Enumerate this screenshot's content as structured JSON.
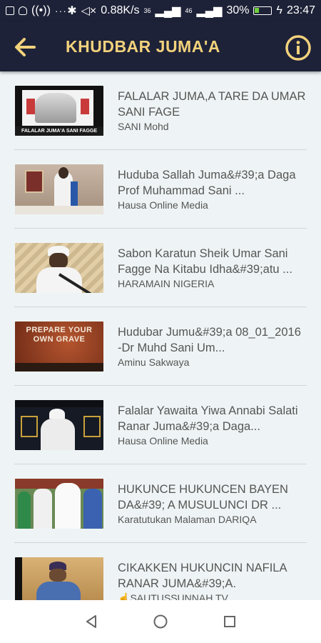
{
  "status_bar": {
    "speed": "0.88K/s",
    "sim1": "36",
    "sim2": "46",
    "battery_percent": "30%",
    "battery_level": 0.3,
    "time": "23:47"
  },
  "toolbar": {
    "title": "KHUDBAR JUMA'A",
    "back_icon": "arrow-left-icon",
    "info_icon": "info-circle-icon",
    "title_color": "#f3d27c",
    "background": "#1e2238"
  },
  "videos": [
    {
      "title": "FALALAR JUMA,A TARE DA UMAR SANI FAGE",
      "channel": "SANI Mohd",
      "thumb_caption": "FALALAR JUMA'A SANI FAGGE"
    },
    {
      "title": "Huduba Sallah Juma&#39;a Daga Prof Muhammad Sani ...",
      "channel": "Hausa Online Media"
    },
    {
      "title": "Sabon Karatun Sheik Umar Sani Fagge Na Kitabu Idha&#39;atu ...",
      "channel": "HARAMAIN NIGERIA"
    },
    {
      "title": "Hudubar Jumu&#39;a 08_01_2016 -Dr Muhd Sani Um...",
      "channel": "Aminu Sakwaya",
      "thumb_caption": "PREPARE YOUR OWN GRAVE"
    },
    {
      "title": "Falalar Yawaita Yiwa Annabi Salati Ranar Juma&#39;a Daga...",
      "channel": "Hausa Online Media"
    },
    {
      "title": "HUKUNCE HUKUNCEN BAYEN DA&#39; A MUSULUNCI DR ...",
      "channel": "Karatutukan Malaman DARIQA"
    },
    {
      "title": "CIKAKKEN HUKUNCIN NAFILA RANAR JUMA&#39;A.",
      "channel": "SAUTUSSUNNAH TV"
    }
  ],
  "nav": {
    "back": "triangle-back-icon",
    "home": "circle-home-icon",
    "recents": "square-recents-icon"
  }
}
